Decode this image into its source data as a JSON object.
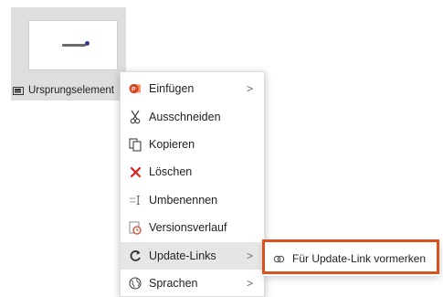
{
  "tile": {
    "label": "Ursprungselement",
    "icon": "slide-icon"
  },
  "menu": {
    "items": [
      {
        "label": "Einfügen",
        "icon": "powerpoint-icon",
        "submenu": true
      },
      {
        "label": "Ausschneiden",
        "icon": "scissors-icon",
        "submenu": false
      },
      {
        "label": "Kopieren",
        "icon": "copy-icon",
        "submenu": false
      },
      {
        "label": "Löschen",
        "icon": "delete-x-icon",
        "submenu": false
      },
      {
        "label": "Umbenennen",
        "icon": "rename-icon",
        "submenu": false
      },
      {
        "label": "Versionsverlauf",
        "icon": "version-history-icon",
        "submenu": false
      },
      {
        "label": "Update-Links",
        "icon": "refresh-icon",
        "submenu": true,
        "highlighted": true
      },
      {
        "label": "Sprachen",
        "icon": "globe-icon",
        "submenu": true
      }
    ],
    "chevron": ">"
  },
  "submenu": {
    "item": {
      "label": "Für Update-Link vormerken",
      "icon": "link-mark-icon"
    }
  },
  "colors": {
    "callout": "#d9531e",
    "delete": "#e0201b",
    "highlight": "#e6e6e6"
  }
}
